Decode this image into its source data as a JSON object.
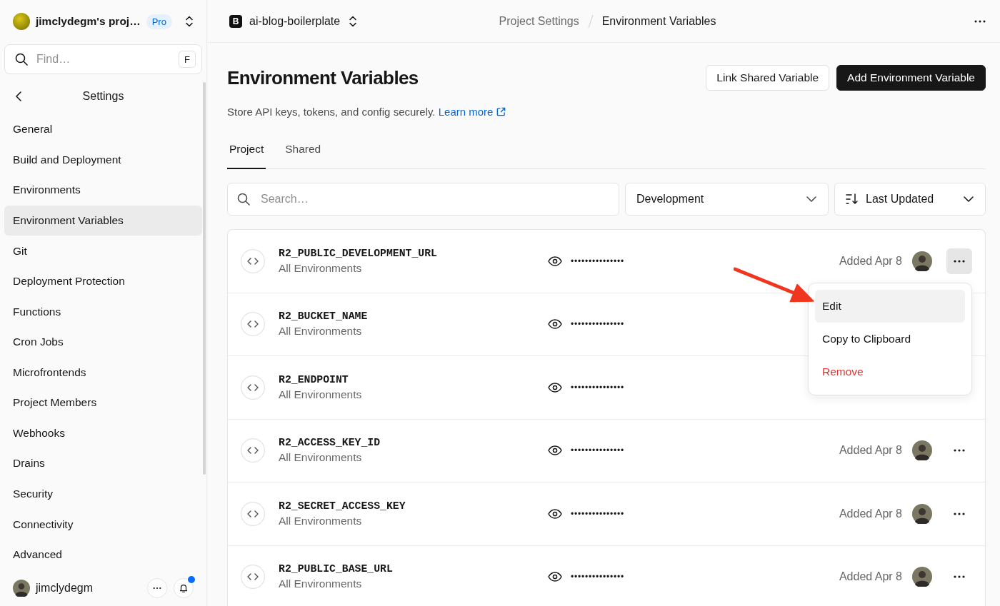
{
  "sidebar": {
    "team": {
      "name": "jimclydegm's proj…",
      "badge": "Pro"
    },
    "find": {
      "placeholder": "Find…",
      "shortcut": "F"
    },
    "section": {
      "title": "Settings"
    },
    "items": [
      {
        "label": "General",
        "selected": false
      },
      {
        "label": "Build and Deployment",
        "selected": false
      },
      {
        "label": "Environments",
        "selected": false
      },
      {
        "label": "Environment Variables",
        "selected": true
      },
      {
        "label": "Git",
        "selected": false
      },
      {
        "label": "Deployment Protection",
        "selected": false
      },
      {
        "label": "Functions",
        "selected": false
      },
      {
        "label": "Cron Jobs",
        "selected": false
      },
      {
        "label": "Microfrontends",
        "selected": false
      },
      {
        "label": "Project Members",
        "selected": false
      },
      {
        "label": "Webhooks",
        "selected": false
      },
      {
        "label": "Drains",
        "selected": false
      },
      {
        "label": "Security",
        "selected": false
      },
      {
        "label": "Connectivity",
        "selected": false
      },
      {
        "label": "Advanced",
        "selected": false
      }
    ],
    "user": {
      "name": "jimclydegm",
      "notification": true
    }
  },
  "topbar": {
    "project_initial": "B",
    "project": "ai-blog-boilerplate",
    "breadcrumbs": [
      {
        "label": "Project Settings",
        "selected": false
      },
      {
        "label": "Environment Variables",
        "selected": true
      }
    ]
  },
  "header": {
    "title": "Environment Variables",
    "buttons": [
      {
        "label": "Link Shared Variable",
        "kind": "secondary"
      },
      {
        "label": "Add Environment Variable",
        "kind": "primary"
      }
    ],
    "description": "Store API keys, tokens, and config securely.",
    "link": "Learn more"
  },
  "tabs": [
    {
      "label": "Project",
      "selected": true
    },
    {
      "label": "Shared",
      "selected": false
    }
  ],
  "filters": {
    "search": {
      "placeholder": "Search…"
    },
    "environment": {
      "value": "Development"
    },
    "sort": {
      "value": "Last Updated"
    }
  },
  "variables": [
    {
      "name": "R2_PUBLIC_DEVELOPMENT_URL",
      "scope": "All Environments",
      "value": "•••••••••••••••",
      "added": "Added Apr 8",
      "menu_open": true
    },
    {
      "name": "R2_BUCKET_NAME",
      "scope": "All Environments",
      "value": "•••••••••••••••"
    },
    {
      "name": "R2_ENDPOINT",
      "scope": "All Environments",
      "value": "•••••••••••••••"
    },
    {
      "name": "R2_ACCESS_KEY_ID",
      "scope": "All Environments",
      "value": "•••••••••••••••",
      "added": "Added Apr 8",
      "menu_open": false
    },
    {
      "name": "R2_SECRET_ACCESS_KEY",
      "scope": "All Environments",
      "value": "•••••••••••••••",
      "added": "Added Apr 8",
      "menu_open": false
    },
    {
      "name": "R2_PUBLIC_BASE_URL",
      "scope": "All Environments",
      "value": "•••••••••••••••",
      "added": "Added Apr 8",
      "menu_open": false
    }
  ],
  "row_menu": {
    "items": [
      {
        "label": "Edit",
        "kind": "normal",
        "selected": true
      },
      {
        "label": "Copy to Clipboard",
        "kind": "normal",
        "selected": false
      },
      {
        "label": "Remove",
        "kind": "danger",
        "selected": false
      }
    ]
  }
}
